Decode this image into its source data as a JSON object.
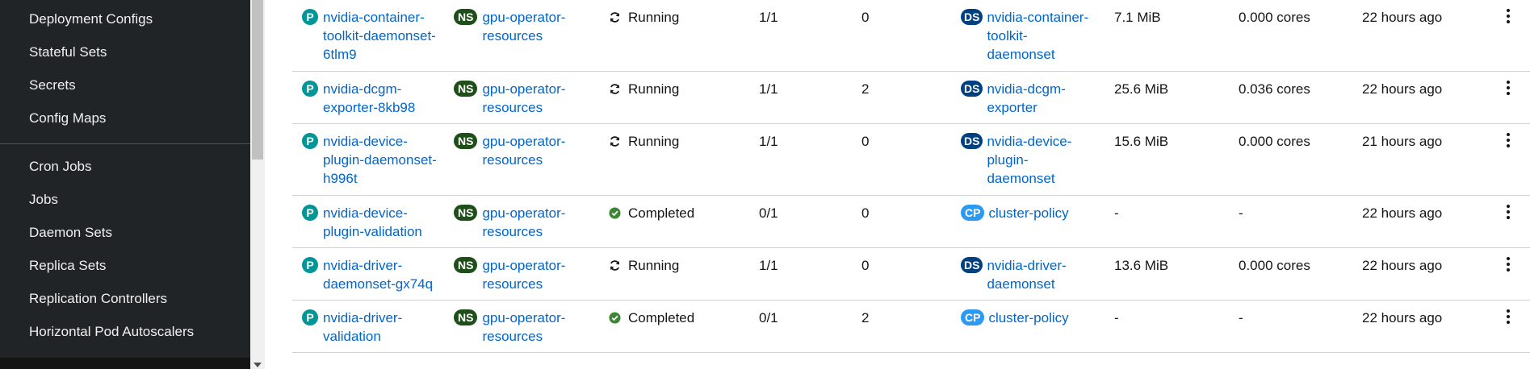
{
  "sidebar": {
    "items": [
      {
        "label": "Deployment Configs"
      },
      {
        "label": "Stateful Sets"
      },
      {
        "label": "Secrets"
      },
      {
        "label": "Config Maps"
      },
      {
        "label": "Cron Jobs"
      },
      {
        "label": "Jobs"
      },
      {
        "label": "Daemon Sets"
      },
      {
        "label": "Replica Sets"
      },
      {
        "label": "Replication Controllers"
      },
      {
        "label": "Horizontal Pod Autoscalers"
      }
    ]
  },
  "badges": {
    "pod": "P",
    "namespace": "NS",
    "daemonset": "DS",
    "clusterpolicy": "CP"
  },
  "colors": {
    "pod": "#009596",
    "namespace": "#1e4f18",
    "daemonset": "#004080",
    "clusterpolicy": "#2b9af3",
    "link": "#0066cc",
    "completed": "#3e8635"
  },
  "rows": [
    {
      "name": "nvidia-container-toolkit-daemonset-6tlm9",
      "namespace": "gpu-operator-resources",
      "status": "Running",
      "status_icon": "sync-icon",
      "ready": "1/1",
      "restarts": "0",
      "owner_kind": "DS",
      "owner": "nvidia-container-toolkit-daemonset",
      "memory": "7.1 MiB",
      "cpu": "0.000 cores",
      "created": "22 hours ago"
    },
    {
      "name": "nvidia-dcgm-exporter-8kb98",
      "namespace": "gpu-operator-resources",
      "status": "Running",
      "status_icon": "sync-icon",
      "ready": "1/1",
      "restarts": "2",
      "owner_kind": "DS",
      "owner": "nvidia-dcgm-exporter",
      "memory": "25.6 MiB",
      "cpu": "0.036 cores",
      "created": "22 hours ago"
    },
    {
      "name": "nvidia-device-plugin-daemonset-h996t",
      "namespace": "gpu-operator-resources",
      "status": "Running",
      "status_icon": "sync-icon",
      "ready": "1/1",
      "restarts": "0",
      "owner_kind": "DS",
      "owner": "nvidia-device-plugin-daemonset",
      "memory": "15.6 MiB",
      "cpu": "0.000 cores",
      "created": "21 hours ago"
    },
    {
      "name": "nvidia-device-plugin-validation",
      "namespace": "gpu-operator-resources",
      "status": "Completed",
      "status_icon": "check-circle-icon",
      "ready": "0/1",
      "restarts": "0",
      "owner_kind": "CP",
      "owner": "cluster-policy",
      "memory": "-",
      "cpu": "-",
      "created": "22 hours ago"
    },
    {
      "name": "nvidia-driver-daemonset-gx74q",
      "namespace": "gpu-operator-resources",
      "status": "Running",
      "status_icon": "sync-icon",
      "ready": "1/1",
      "restarts": "0",
      "owner_kind": "DS",
      "owner": "nvidia-driver-daemonset",
      "memory": "13.6 MiB",
      "cpu": "0.000 cores",
      "created": "22 hours ago"
    },
    {
      "name": "nvidia-driver-validation",
      "namespace": "gpu-operator-resources",
      "status": "Completed",
      "status_icon": "check-circle-icon",
      "ready": "0/1",
      "restarts": "2",
      "owner_kind": "CP",
      "owner": "cluster-policy",
      "memory": "-",
      "cpu": "-",
      "created": "22 hours ago"
    }
  ]
}
